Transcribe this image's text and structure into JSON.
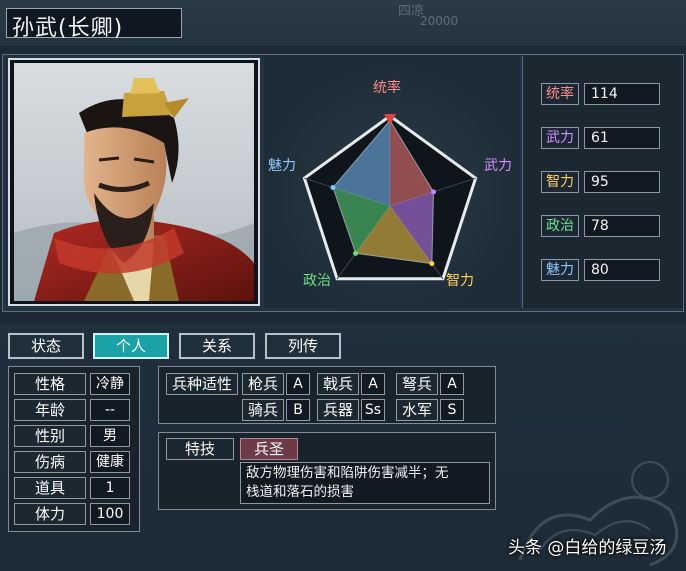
{
  "top_overlay": {
    "faded_text": "四凉",
    "faded_number": "20000"
  },
  "character": {
    "name": "孙武(长卿)"
  },
  "radar": {
    "labels": {
      "command": "统率",
      "force": "武力",
      "intelligence": "智力",
      "politics": "政治",
      "charm": "魅力"
    },
    "label_colors": {
      "command": "#ff8a8a",
      "force": "#d58cff",
      "intelligence": "#ffd35a",
      "politics": "#69e08a",
      "charm": "#8ec7ff"
    }
  },
  "chart_data": {
    "type": "radar",
    "categories": [
      "统率",
      "武力",
      "智力",
      "政治",
      "魅力"
    ],
    "values": [
      114,
      61,
      95,
      78,
      80
    ],
    "max": 120
  },
  "stats": [
    {
      "label": "统率",
      "value": "114",
      "color": "#ff8a8a"
    },
    {
      "label": "武力",
      "value": "61",
      "color": "#d58cff"
    },
    {
      "label": "智力",
      "value": "95",
      "color": "#ffd35a"
    },
    {
      "label": "政治",
      "value": "78",
      "color": "#69e08a"
    },
    {
      "label": "魅力",
      "value": "80",
      "color": "#8ec7ff"
    }
  ],
  "tabs": [
    {
      "label": "状态",
      "active": false
    },
    {
      "label": "个人",
      "active": true
    },
    {
      "label": "关系",
      "active": false
    },
    {
      "label": "列传",
      "active": false
    }
  ],
  "personal": [
    {
      "label": "性格",
      "value": "冷静"
    },
    {
      "label": "年龄",
      "value": "--"
    },
    {
      "label": "性别",
      "value": "男"
    },
    {
      "label": "伤病",
      "value": "健康"
    },
    {
      "label": "道具",
      "value": "1"
    },
    {
      "label": "体力",
      "value": "100"
    }
  ],
  "troop": {
    "title": "兵种适性",
    "row1": [
      {
        "label": "枪兵",
        "grade": "A"
      },
      {
        "label": "戟兵",
        "grade": "A"
      },
      {
        "label": "弩兵",
        "grade": "A"
      }
    ],
    "row2": [
      {
        "label": "骑兵",
        "grade": "B"
      },
      {
        "label": "兵器",
        "grade": "Ss"
      },
      {
        "label": "水军",
        "grade": "S"
      }
    ]
  },
  "skill": {
    "title": "特技",
    "name": "兵圣",
    "desc_line1": "敌方物理伤害和陷阱伤害减半；无",
    "desc_line2": "栈道和落石的损害"
  },
  "watermark": "头条 @白给的绿豆汤"
}
